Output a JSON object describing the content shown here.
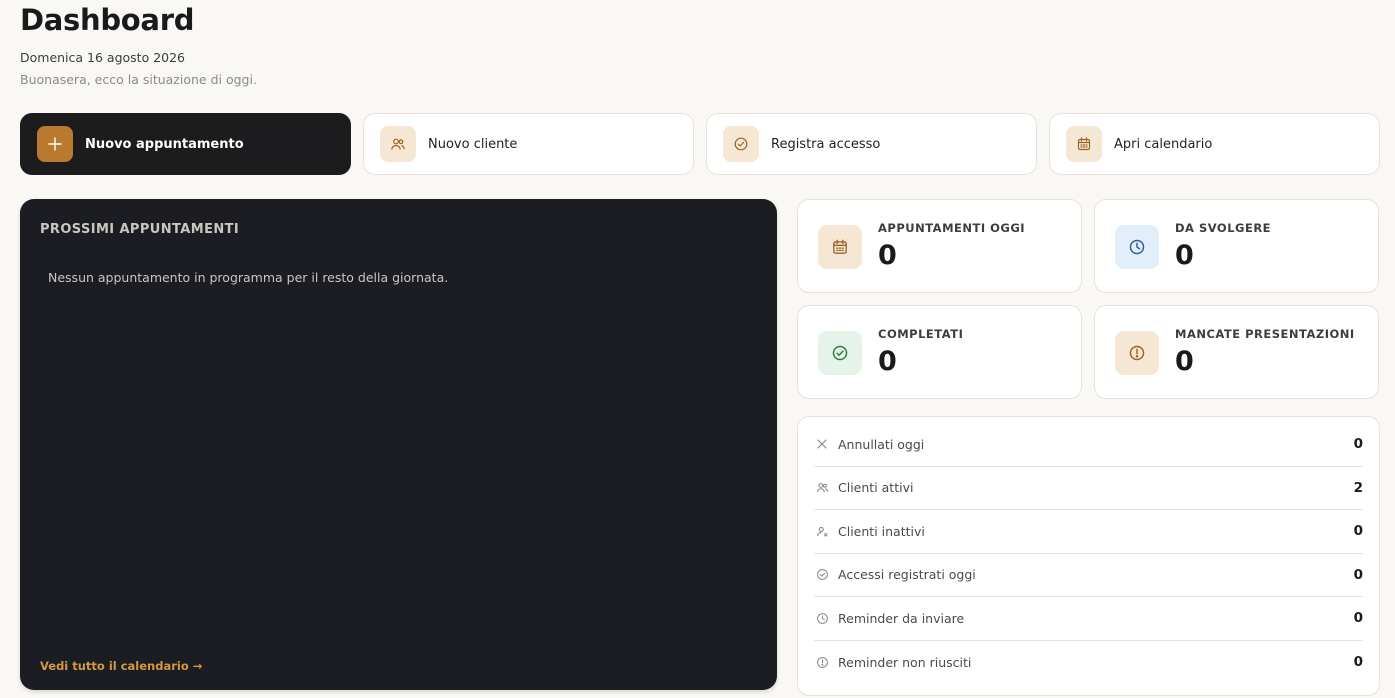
{
  "header": {
    "title": "Dashboard",
    "date": "Domenica 16 agosto 2026",
    "greeting": "Buonasera, ecco la situazione di oggi."
  },
  "actions": [
    {
      "label": "Nuovo appuntamento",
      "icon": "plus-icon"
    },
    {
      "label": "Nuovo cliente",
      "icon": "users-icon"
    },
    {
      "label": "Registra accesso",
      "icon": "check-circle-icon"
    },
    {
      "label": "Apri calendario",
      "icon": "calendar-icon"
    }
  ],
  "upcoming": {
    "title": "PROSSIMI APPUNTAMENTI",
    "empty": "Nessun appuntamento in programma per il resto della giornata.",
    "link": "Vedi tutto il calendario →"
  },
  "stats": [
    {
      "label": "APPUNTAMENTI OGGI",
      "value": "0",
      "icon": "calendar-icon"
    },
    {
      "label": "DA SVOLGERE",
      "value": "0",
      "icon": "clock-icon"
    },
    {
      "label": "COMPLETATI",
      "value": "0",
      "icon": "check-circle-icon"
    },
    {
      "label": "MANCATE PRESENTAZIONI",
      "value": "0",
      "icon": "alert-circle-icon"
    }
  ],
  "summary": [
    {
      "label": "Annullati oggi",
      "value": "0",
      "icon": "x-icon"
    },
    {
      "label": "Clienti attivi",
      "value": "2",
      "icon": "users-icon"
    },
    {
      "label": "Clienti inattivi",
      "value": "0",
      "icon": "user-x-icon"
    },
    {
      "label": "Accessi registrati oggi",
      "value": "0",
      "icon": "check-circle-icon"
    },
    {
      "label": "Reminder da inviare",
      "value": "0",
      "icon": "clock-icon"
    },
    {
      "label": "Reminder non riusciti",
      "value": "0",
      "icon": "alert-circle-icon"
    }
  ],
  "colors": {
    "accent": "#b97a2f",
    "link": "#d19a3f",
    "dark_card": "#1c1d22",
    "icon_bg_warm": "#f5e7d3",
    "icon_bg_blue": "#e3eefb",
    "icon_bg_green": "#e4f4e8"
  }
}
